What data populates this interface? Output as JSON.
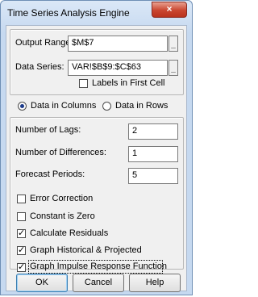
{
  "window": {
    "title": "Time Series Analysis Engine",
    "close_glyph": "×"
  },
  "inputs": {
    "output_range": {
      "label": "Output Range:",
      "value": "$M$7"
    },
    "data_series": {
      "label": "Data Series:",
      "value": "VAR!$B$9:$C$63"
    },
    "browse_glyph": "_",
    "labels_first_cell": {
      "label": "Labels in First Cell",
      "checked": false
    }
  },
  "orientation": {
    "columns": {
      "label": "Data in Columns",
      "selected": true
    },
    "rows": {
      "label": "Data in Rows",
      "selected": false
    }
  },
  "params": {
    "lags": {
      "label": "Number of Lags:",
      "value": "2"
    },
    "differences": {
      "label": "Number of Differences:",
      "value": "1"
    },
    "forecast": {
      "label": "Forecast Periods:",
      "value": "5"
    }
  },
  "options": [
    {
      "label": "Error Correction",
      "checked": false
    },
    {
      "label": "Constant is Zero",
      "checked": false
    },
    {
      "label": "Calculate Residuals",
      "checked": true
    },
    {
      "label": "Graph Historical & Projected",
      "checked": true
    },
    {
      "label": "Graph Impulse Response Function",
      "checked": true
    }
  ],
  "check_glyph": "✓",
  "buttons": {
    "ok": "OK",
    "cancel": "Cancel",
    "help": "Help"
  }
}
